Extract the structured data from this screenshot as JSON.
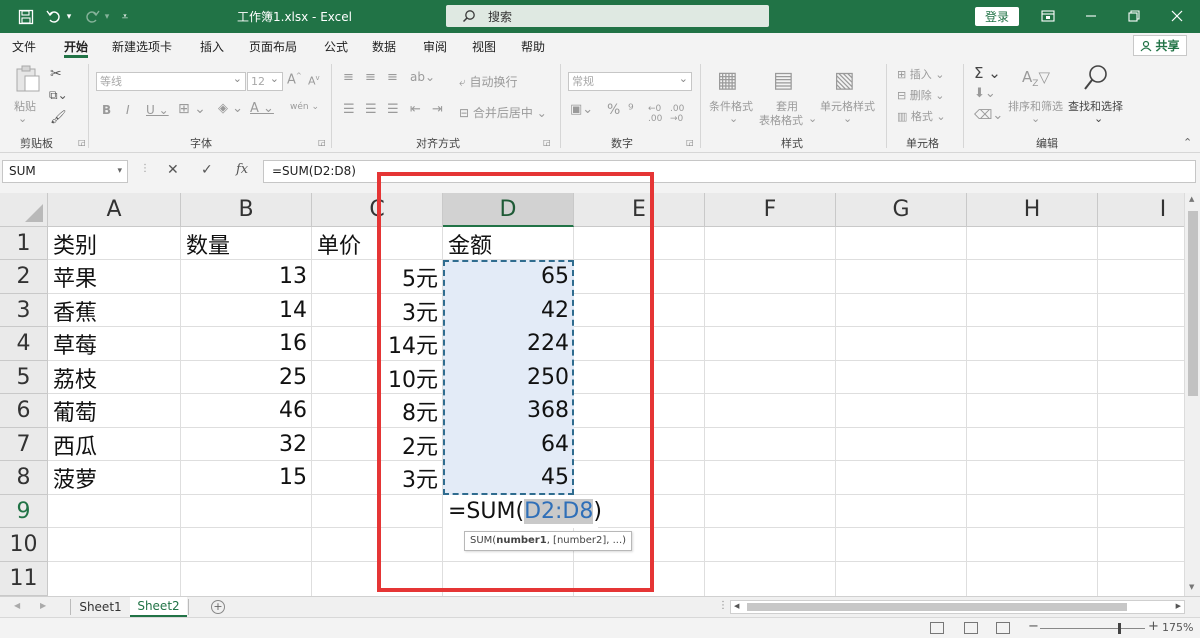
{
  "window": {
    "title": "工作簿1.xlsx  -  Excel",
    "search_label": "搜索",
    "login_label": "登录",
    "share_label": "共享"
  },
  "tabs": [
    "文件",
    "开始",
    "新建选项卡",
    "插入",
    "页面布局",
    "公式",
    "数据",
    "审阅",
    "视图",
    "帮助"
  ],
  "active_tab": "开始",
  "ribbon": {
    "clipboard": {
      "label": "剪贴板",
      "paste": "粘贴"
    },
    "font": {
      "label": "字体",
      "font_name": "等线",
      "font_size": "12"
    },
    "alignment": {
      "label": "对齐方式",
      "wrap": "自动换行",
      "merge": "合并后居中"
    },
    "number": {
      "label": "数字",
      "format": "常规"
    },
    "styles": {
      "label": "样式",
      "conditional": "条件格式",
      "as_table_1": "套用",
      "as_table_2": "表格格式",
      "cell_styles": "单元格样式"
    },
    "cells": {
      "label": "单元格",
      "insert": "插入",
      "delete": "删除",
      "format": "格式"
    },
    "editing": {
      "label": "编辑",
      "sort": "排序和筛选",
      "find": "查找和选择"
    }
  },
  "formula_bar": {
    "name_box": "SUM",
    "formula": "=SUM(D2:D8)"
  },
  "columns": [
    "A",
    "B",
    "C",
    "D",
    "E",
    "F",
    "G",
    "H",
    "I"
  ],
  "rows": [
    "1",
    "2",
    "3",
    "4",
    "5",
    "6",
    "7",
    "8",
    "9",
    "10",
    "11"
  ],
  "table": [
    [
      "类别",
      "数量",
      "单价",
      "金额"
    ],
    [
      "苹果",
      "13",
      "5元",
      "65"
    ],
    [
      "香蕉",
      "14",
      "3元",
      "42"
    ],
    [
      "草莓",
      "16",
      "14元",
      "224"
    ],
    [
      "荔枝",
      "25",
      "10元",
      "250"
    ],
    [
      "葡萄",
      "46",
      "8元",
      "368"
    ],
    [
      "西瓜",
      "32",
      "2元",
      "64"
    ],
    [
      "菠萝",
      "15",
      "3元",
      "45"
    ]
  ],
  "editing_cell": {
    "prefix": "=SUM(",
    "ref": "D2:D8",
    "suffix": ")",
    "tooltip_fn": "SUM(",
    "tooltip_arg1": "number1",
    "tooltip_rest": ", [number2], ...)"
  },
  "sheets": [
    "Sheet1",
    "Sheet2"
  ],
  "active_sheet": "Sheet2",
  "status": {
    "zoom": "175%"
  },
  "colors": {
    "excel_green": "#217346",
    "highlight_red": "#e53535",
    "selection_fill": "#e3ebf7"
  }
}
